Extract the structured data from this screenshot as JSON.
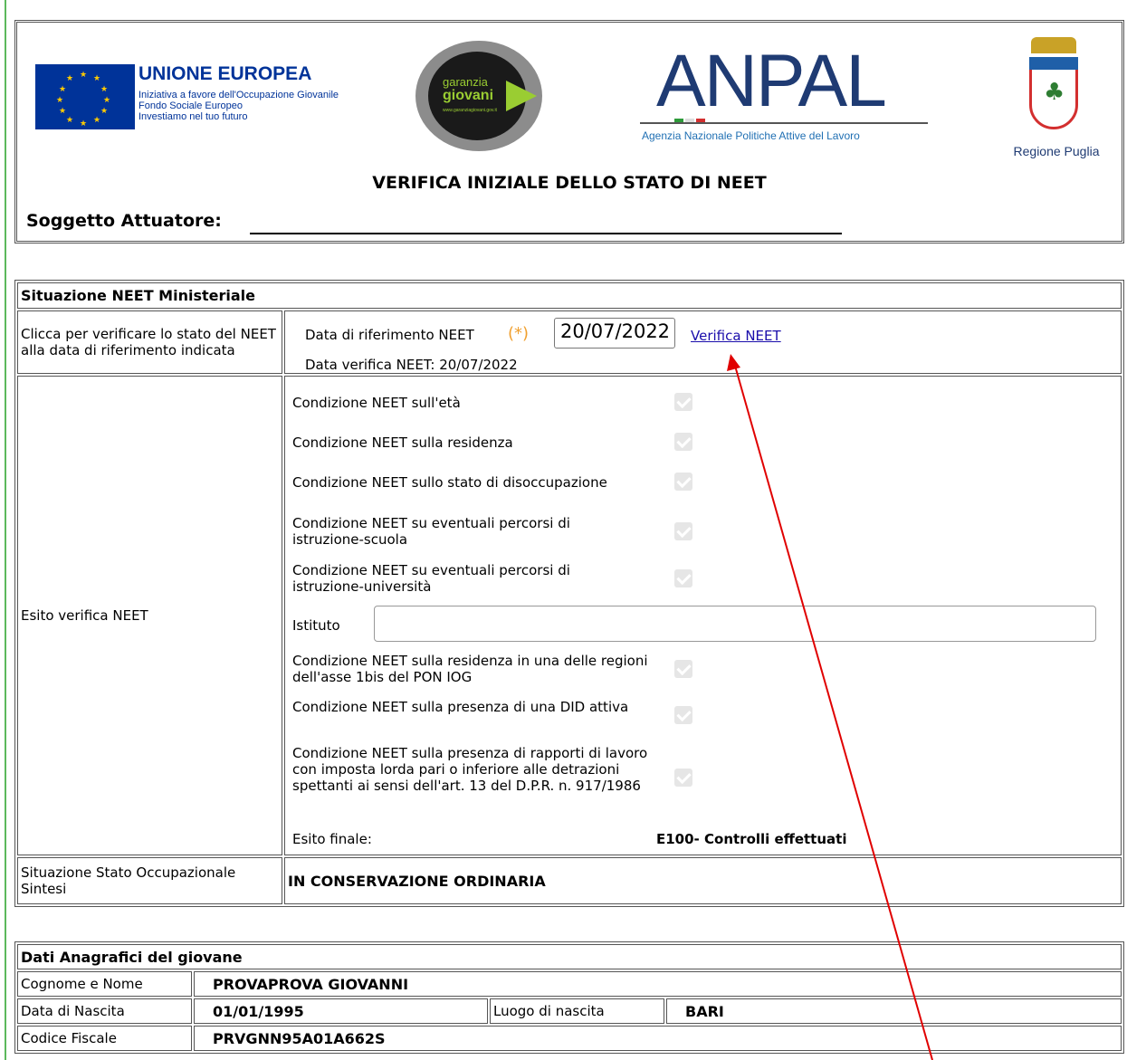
{
  "header": {
    "eu_title": "UNIONE EUROPEA",
    "eu_line1": "Iniziativa a favore dell'Occupazione Giovanile",
    "eu_line2": "Fondo Sociale Europeo",
    "eu_line3": "Investiamo nel tuo futuro",
    "gg_line1": "garanzia",
    "gg_line2": "giovani",
    "gg_url": "www.garanziagiovani.gov.it",
    "anpal_word": "ANPAL",
    "anpal_sub": "Agenzia Nazionale Politiche Attive del Lavoro",
    "region_label": "Regione Puglia",
    "title": "VERIFICA INIZIALE DELLO STATO DI NEET",
    "soggetto_label": "Soggetto Attuatore:"
  },
  "neet": {
    "section_title": "Situazione NEET Ministeriale",
    "click_label": "Clicca per verificare lo stato del NEET alla data di riferimento indicata",
    "date_label": "Data di riferimento NEET",
    "required_mark": "(*)",
    "date_value": "20/07/2022",
    "verify_link": "Verifica NEET",
    "verified_text": "Data verifica NEET: 20/07/2022",
    "esito_label": "Esito verifica NEET",
    "conditions": [
      {
        "label": "Condizione NEET sull'età",
        "checked": true
      },
      {
        "label": "Condizione NEET sulla residenza",
        "checked": true
      },
      {
        "label": "Condizione NEET sullo stato di disoccupazione",
        "checked": true
      },
      {
        "label": "Condizione NEET su eventuali percorsi di istruzione-scuola",
        "checked": true
      },
      {
        "label": "Condizione NEET su eventuali percorsi di istruzione-università",
        "checked": true
      },
      {
        "label": "Condizione NEET sulla residenza in una delle regioni dell'asse 1bis del PON IOG",
        "checked": true
      },
      {
        "label": "Condizione NEET sulla presenza di una DID attiva",
        "checked": true
      },
      {
        "label": "Condizione NEET sulla presenza di rapporti di lavoro con imposta lorda pari o inferiore alle detrazioni spettanti ai sensi dell'art. 13 del D.P.R. n. 917/1986",
        "checked": true
      }
    ],
    "istituto_label": "Istituto",
    "istituto_value": "",
    "esito_finale_label": "Esito finale:",
    "esito_finale_value": "E100- Controlli effettuati",
    "stato_label": "Situazione Stato Occupazionale Sintesi",
    "stato_value": "IN CONSERVAZIONE ORDINARIA"
  },
  "anagrafica": {
    "section_title": "Dati Anagrafici del giovane",
    "nome_label": "Cognome e Nome",
    "nome_value": "PROVAPROVA GIOVANNI",
    "nascita_label": "Data di Nascita",
    "nascita_value": "01/01/1995",
    "luogo_label": "Luogo di nascita",
    "luogo_value": "BARI",
    "cf_label": "Codice Fiscale",
    "cf_value": "PRVGNN95A01A662S"
  },
  "colors": {
    "annotation_arrow": "#e00000",
    "link": "#1a0dab",
    "required": "#f0a030",
    "left_border": "#5cb85c"
  }
}
